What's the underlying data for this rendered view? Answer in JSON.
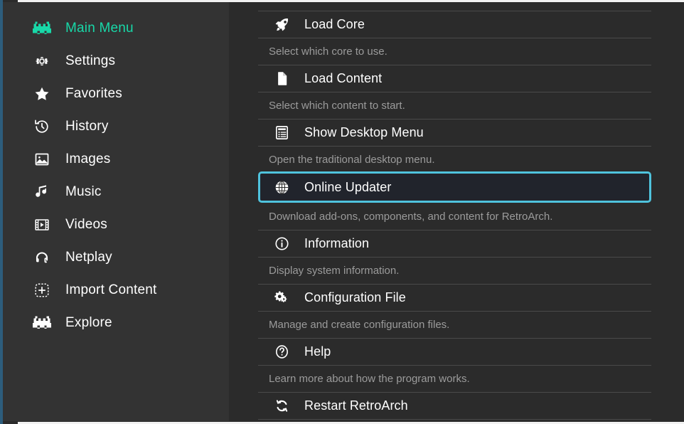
{
  "theme": {
    "accent_teal": "#18d8a8",
    "highlight_cyan": "#4fc3dd",
    "sidebar_bg": "#333333",
    "content_bg": "#2b2b2b",
    "selected_row_bg": "#21242c",
    "text_primary": "#ffffff",
    "text_sublabel": "#9b9b9b",
    "separator": "#4a4a4a",
    "edge_strip": "#2d5d7c"
  },
  "sidebar": {
    "items": [
      {
        "label": "Main Menu",
        "icon": "space-invader-icon",
        "active": true
      },
      {
        "label": "Settings",
        "icon": "gear-icon",
        "active": false
      },
      {
        "label": "Favorites",
        "icon": "star-icon",
        "active": false
      },
      {
        "label": "History",
        "icon": "clock-history-icon",
        "active": false
      },
      {
        "label": "Images",
        "icon": "image-icon",
        "active": false
      },
      {
        "label": "Music",
        "icon": "music-note-icon",
        "active": false
      },
      {
        "label": "Videos",
        "icon": "film-icon",
        "active": false
      },
      {
        "label": "Netplay",
        "icon": "headset-icon",
        "active": false
      },
      {
        "label": "Import Content",
        "icon": "plus-dashed-icon",
        "active": false
      },
      {
        "label": "Explore",
        "icon": "space-invader-icon",
        "active": false
      }
    ]
  },
  "main": {
    "entries": [
      {
        "label": "Load Core",
        "sublabel": "Select which core to use.",
        "icon": "rocket-icon",
        "selected": false
      },
      {
        "label": "Load Content",
        "sublabel": "Select which content to start.",
        "icon": "file-icon",
        "selected": false
      },
      {
        "label": "Show Desktop Menu",
        "sublabel": "Open the traditional desktop menu.",
        "icon": "desktop-list-icon",
        "selected": false
      },
      {
        "label": "Online Updater",
        "sublabel": "Download add-ons, components, and content for RetroArch.",
        "icon": "globe-icon",
        "selected": true
      },
      {
        "label": "Information",
        "sublabel": "Display system information.",
        "icon": "info-circle-icon",
        "selected": false
      },
      {
        "label": "Configuration File",
        "sublabel": "Manage and create configuration files.",
        "icon": "cogs-icon",
        "selected": false
      },
      {
        "label": "Help",
        "sublabel": "Learn more about how the program works.",
        "icon": "question-circle-icon",
        "selected": false
      },
      {
        "label": "Restart RetroArch",
        "sublabel": "",
        "icon": "restart-icon",
        "selected": false
      }
    ]
  }
}
